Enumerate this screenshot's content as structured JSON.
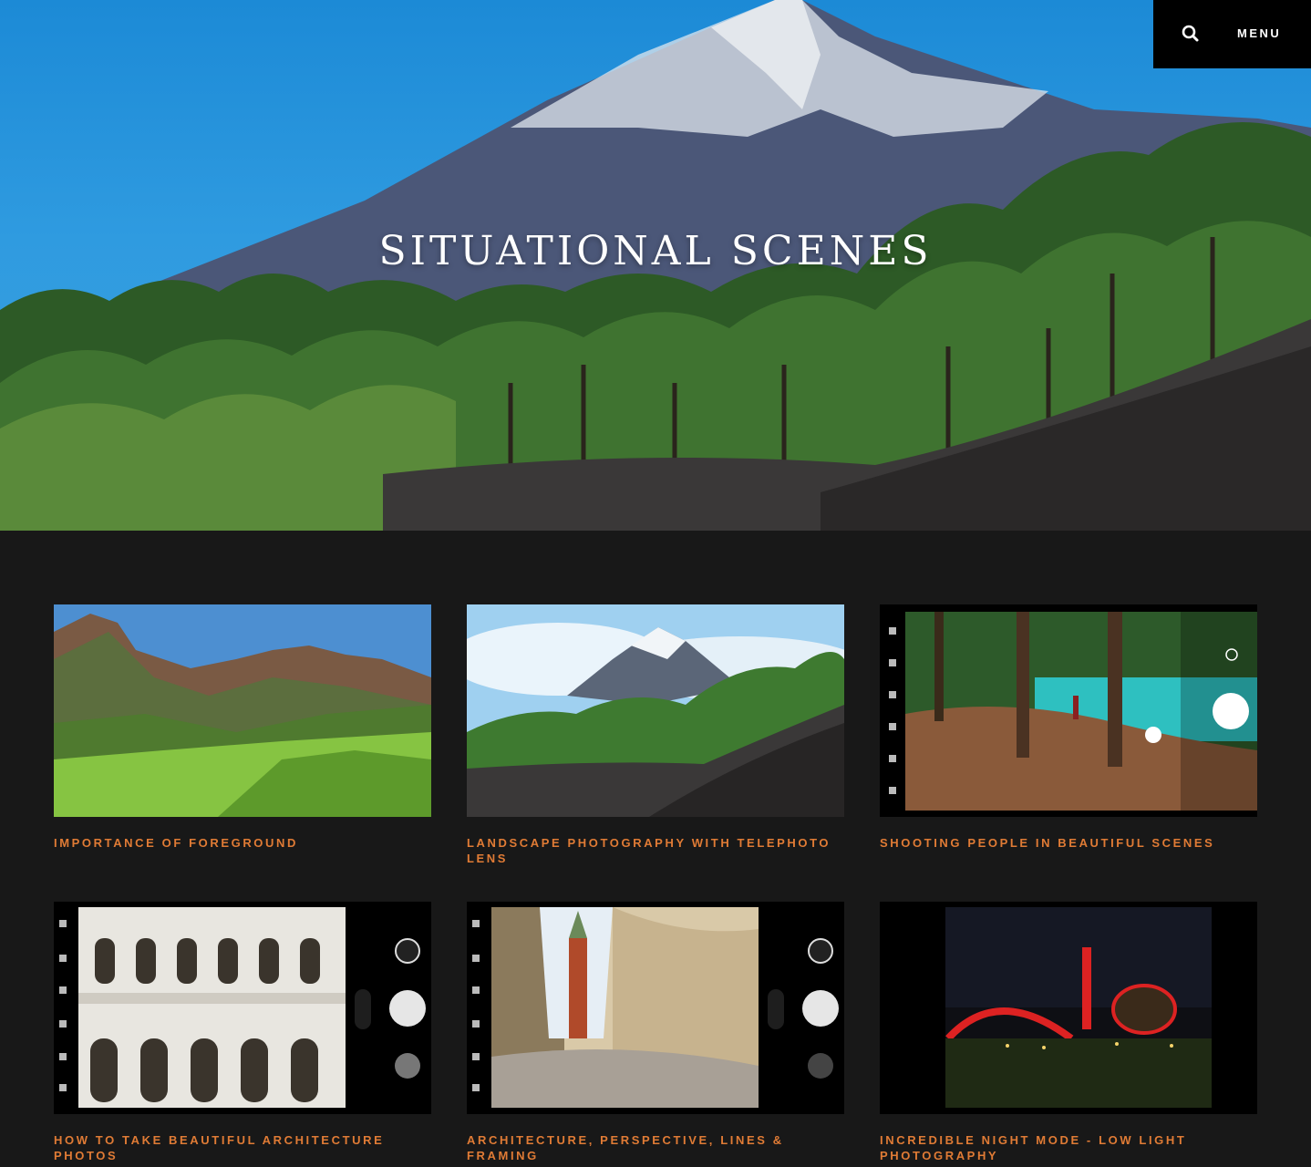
{
  "header": {
    "menu_label": "MENU",
    "search_icon": "search-icon"
  },
  "hero": {
    "title": "SITUATIONAL SCENES"
  },
  "posts": [
    {
      "title": "IMPORTANCE OF FOREGROUND"
    },
    {
      "title": "LANDSCAPE PHOTOGRAPHY WITH TELEPHOTO LENS"
    },
    {
      "title": "SHOOTING PEOPLE IN BEAUTIFUL SCENES"
    },
    {
      "title": "HOW TO TAKE BEAUTIFUL ARCHITECTURE PHOTOS"
    },
    {
      "title": "ARCHITECTURE, PERSPECTIVE, LINES & FRAMING"
    },
    {
      "title": "INCREDIBLE NIGHT MODE - LOW LIGHT PHOTOGRAPHY"
    }
  ],
  "colors": {
    "accent": "#e07b35",
    "background": "#181818",
    "header_bg": "#000000"
  }
}
